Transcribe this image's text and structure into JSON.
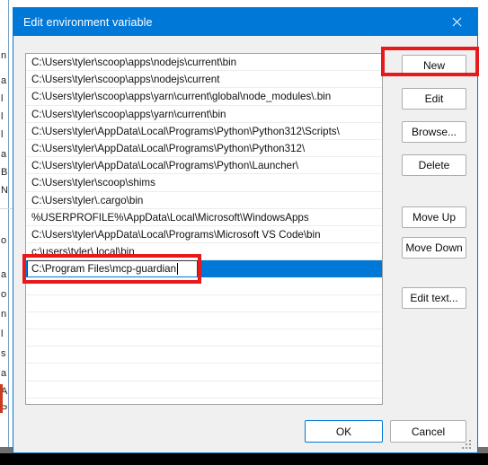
{
  "window": {
    "title": "Edit environment variable",
    "close_label": "Close",
    "close_icon": "close-icon",
    "titlebar_color": "#0078d7",
    "accent_color": "#0078d7",
    "annotation_color": "#e8191b"
  },
  "list": {
    "items": [
      "C:\\Users\\tyler\\scoop\\apps\\nodejs\\current\\bin",
      "C:\\Users\\tyler\\scoop\\apps\\nodejs\\current",
      "C:\\Users\\tyler\\scoop\\apps\\yarn\\current\\global\\node_modules\\.bin",
      "C:\\Users\\tyler\\scoop\\apps\\yarn\\current\\bin",
      "C:\\Users\\tyler\\AppData\\Local\\Programs\\Python\\Python312\\Scripts\\",
      "C:\\Users\\tyler\\AppData\\Local\\Programs\\Python\\Python312\\",
      "C:\\Users\\tyler\\AppData\\Local\\Programs\\Python\\Launcher\\",
      "C:\\Users\\tyler\\scoop\\shims",
      "C:\\Users\\tyler\\.cargo\\bin",
      "%USERPROFILE%\\AppData\\Local\\Microsoft\\WindowsApps",
      "C:\\Users\\tyler\\AppData\\Local\\Programs\\Microsoft VS Code\\bin",
      "c:\\users\\tyler\\.local\\bin"
    ],
    "editing_row": {
      "value": "C:\\Program Files\\mcp-guardian",
      "selected": true,
      "annotated": true
    },
    "empty_row_count": 8
  },
  "side_buttons": [
    {
      "label": "New",
      "annotated": true
    },
    {
      "label": "Edit",
      "annotated": false
    },
    {
      "label": "Browse...",
      "annotated": false
    },
    {
      "label": "Delete",
      "annotated": false
    },
    {
      "label": "Move Up",
      "annotated": false
    },
    {
      "label": "Move Down",
      "annotated": false
    },
    {
      "label": "Edit text...",
      "annotated": false
    }
  ],
  "footer": {
    "ok_label": "OK",
    "cancel_label": "Cancel",
    "resize_grip": "resize-grip-icon"
  },
  "background_window": {
    "fragments": [
      "n",
      "a",
      "l",
      "l",
      "l",
      "a",
      "B",
      "N",
      "o",
      "a",
      "o",
      "n",
      "l",
      "s",
      "a",
      "A",
      "P"
    ]
  }
}
